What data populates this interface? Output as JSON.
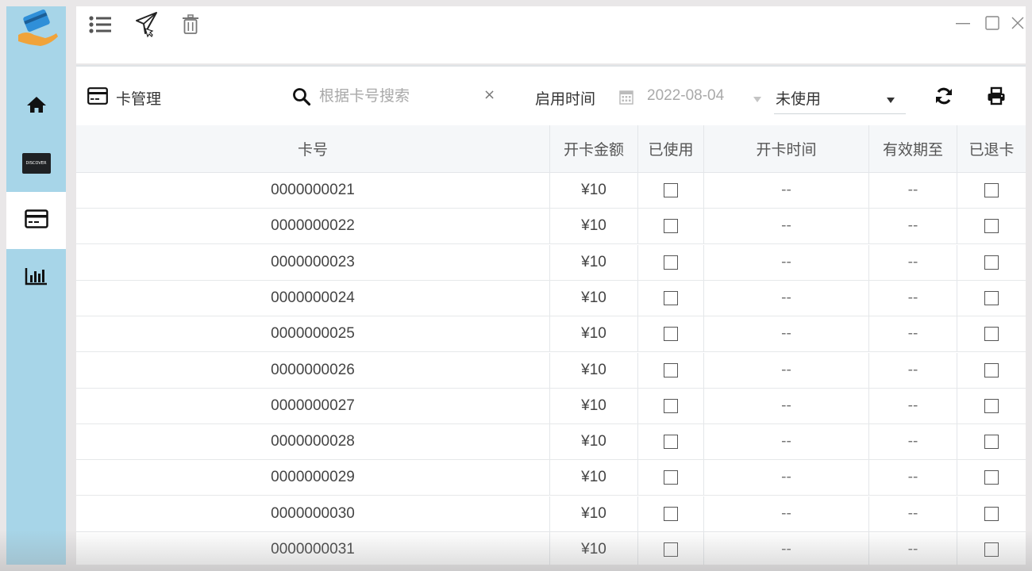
{
  "sidebar": {
    "items": [
      {
        "name": "home-icon",
        "active": false
      },
      {
        "name": "discover-card-icon",
        "badge_text": "DISCOVER",
        "active": false
      },
      {
        "name": "credit-card-icon",
        "active": true
      },
      {
        "name": "bar-chart-icon",
        "active": false
      }
    ]
  },
  "toolbar": {
    "icons": [
      "list-icon",
      "send-icon",
      "trash-icon"
    ]
  },
  "window_controls": [
    "minimize-icon",
    "maximize-icon",
    "close-icon"
  ],
  "panel": {
    "title": "卡管理",
    "search": {
      "placeholder": "根据卡号搜索",
      "value": "",
      "clear_label": "×"
    },
    "date_filter": {
      "label": "启用时间",
      "value": "2022-08-04"
    },
    "status_select": {
      "value": "未使用"
    },
    "actions": [
      "refresh-icon",
      "print-icon"
    ]
  },
  "table": {
    "columns": [
      "卡号",
      "开卡金额",
      "已使用",
      "开卡时间",
      "有效期至",
      "已退卡"
    ],
    "rows": [
      {
        "card_no": "0000000021",
        "amount": "¥10",
        "used": false,
        "open_time": "--",
        "valid_until": "--",
        "refunded": false
      },
      {
        "card_no": "0000000022",
        "amount": "¥10",
        "used": false,
        "open_time": "--",
        "valid_until": "--",
        "refunded": false
      },
      {
        "card_no": "0000000023",
        "amount": "¥10",
        "used": false,
        "open_time": "--",
        "valid_until": "--",
        "refunded": false
      },
      {
        "card_no": "0000000024",
        "amount": "¥10",
        "used": false,
        "open_time": "--",
        "valid_until": "--",
        "refunded": false
      },
      {
        "card_no": "0000000025",
        "amount": "¥10",
        "used": false,
        "open_time": "--",
        "valid_until": "--",
        "refunded": false
      },
      {
        "card_no": "0000000026",
        "amount": "¥10",
        "used": false,
        "open_time": "--",
        "valid_until": "--",
        "refunded": false
      },
      {
        "card_no": "0000000027",
        "amount": "¥10",
        "used": false,
        "open_time": "--",
        "valid_until": "--",
        "refunded": false
      },
      {
        "card_no": "0000000028",
        "amount": "¥10",
        "used": false,
        "open_time": "--",
        "valid_until": "--",
        "refunded": false
      },
      {
        "card_no": "0000000029",
        "amount": "¥10",
        "used": false,
        "open_time": "--",
        "valid_until": "--",
        "refunded": false
      },
      {
        "card_no": "0000000030",
        "amount": "¥10",
        "used": false,
        "open_time": "--",
        "valid_until": "--",
        "refunded": false
      },
      {
        "card_no": "0000000031",
        "amount": "¥10",
        "used": false,
        "open_time": "--",
        "valid_until": "--",
        "refunded": false
      }
    ]
  },
  "colors": {
    "sidebar_bg": "#a7d5e8",
    "active_nav": "#ffffff",
    "header_bg": "#f5f7f9"
  }
}
